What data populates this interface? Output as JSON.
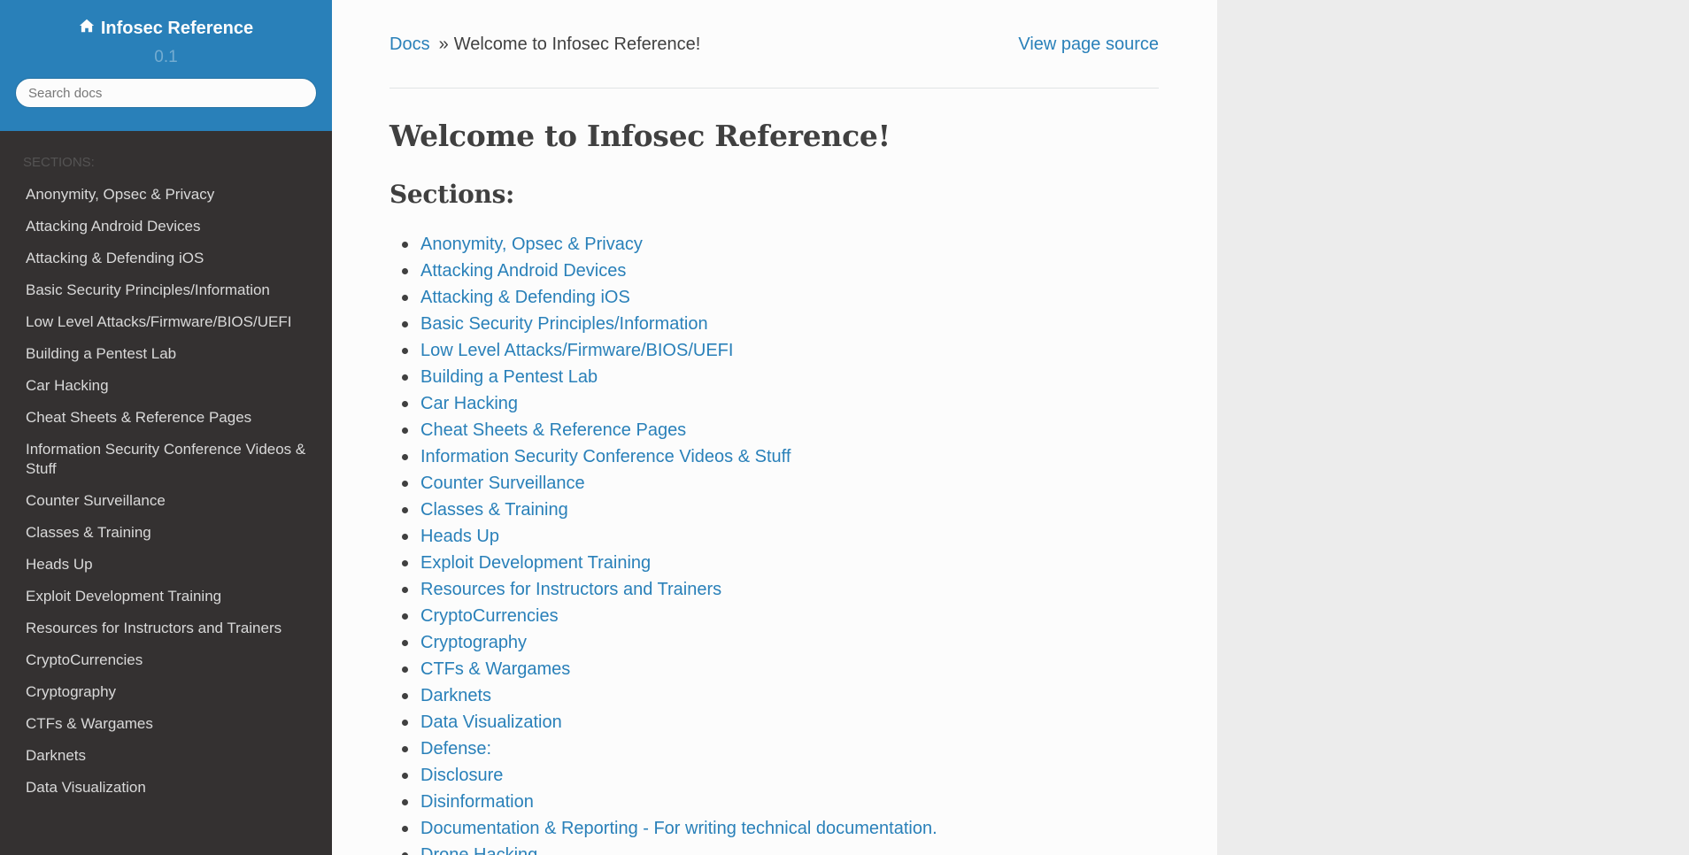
{
  "sidebar": {
    "brand": "Infosec Reference",
    "version": "0.1",
    "search_placeholder": "Search docs",
    "caption": "Sections:",
    "items": [
      {
        "label": "Anonymity, Opsec & Privacy"
      },
      {
        "label": "Attacking Android Devices"
      },
      {
        "label": "Attacking & Defending iOS"
      },
      {
        "label": "Basic Security Principles/Information"
      },
      {
        "label": "Low Level Attacks/Firmware/BIOS/UEFI"
      },
      {
        "label": "Building a Pentest Lab"
      },
      {
        "label": "Car Hacking"
      },
      {
        "label": "Cheat Sheets & Reference Pages"
      },
      {
        "label": "Information Security Conference Videos & Stuff"
      },
      {
        "label": "Counter Surveillance"
      },
      {
        "label": "Classes & Training"
      },
      {
        "label": "Heads Up"
      },
      {
        "label": "Exploit Development Training"
      },
      {
        "label": "Resources for Instructors and Trainers"
      },
      {
        "label": "CryptoCurrencies"
      },
      {
        "label": "Cryptography"
      },
      {
        "label": "CTFs & Wargames"
      },
      {
        "label": "Darknets"
      },
      {
        "label": "Data Visualization"
      }
    ]
  },
  "breadcrumbs": {
    "docs": "Docs",
    "separator": "»",
    "current": "Welcome to Infosec Reference!",
    "view_source": "View page source"
  },
  "main": {
    "title": "Welcome to Infosec Reference!",
    "sections_heading": "Sections:",
    "toc": [
      {
        "label": "Anonymity, Opsec & Privacy"
      },
      {
        "label": "Attacking Android Devices"
      },
      {
        "label": "Attacking & Defending iOS"
      },
      {
        "label": "Basic Security Principles/Information"
      },
      {
        "label": "Low Level Attacks/Firmware/BIOS/UEFI"
      },
      {
        "label": "Building a Pentest Lab"
      },
      {
        "label": "Car Hacking"
      },
      {
        "label": "Cheat Sheets & Reference Pages"
      },
      {
        "label": "Information Security Conference Videos & Stuff"
      },
      {
        "label": "Counter Surveillance"
      },
      {
        "label": "Classes & Training"
      },
      {
        "label": "Heads Up"
      },
      {
        "label": "Exploit Development Training"
      },
      {
        "label": "Resources for Instructors and Trainers"
      },
      {
        "label": "CryptoCurrencies"
      },
      {
        "label": "Cryptography"
      },
      {
        "label": "CTFs & Wargames"
      },
      {
        "label": "Darknets"
      },
      {
        "label": "Data Visualization"
      },
      {
        "label": "Defense:"
      },
      {
        "label": "Disclosure"
      },
      {
        "label": "Disinformation"
      },
      {
        "label": "Documentation & Reporting - For writing technical documentation."
      },
      {
        "label": "Drone Hacking"
      }
    ]
  },
  "colors": {
    "sidebar_top": "#2980b9",
    "sidebar_bg": "#343131",
    "link": "#2980b9",
    "content_bg": "#fcfcfc",
    "page_bg": "#ececec"
  },
  "icons": {
    "brand_icon": "home-icon"
  }
}
